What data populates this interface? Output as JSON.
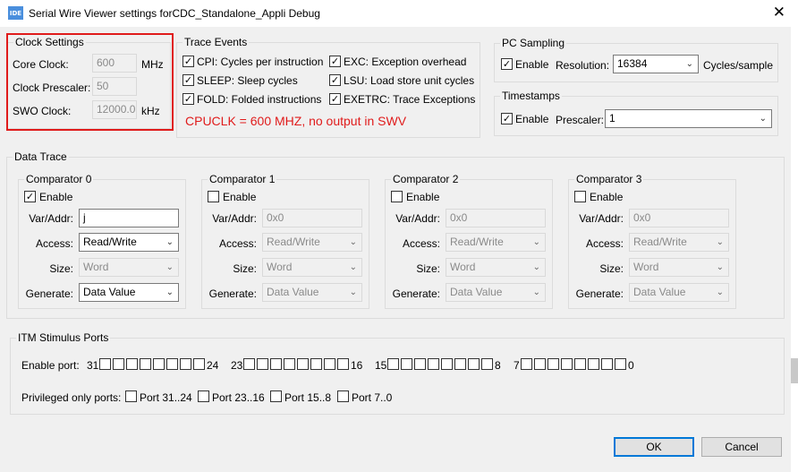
{
  "window": {
    "icon_text": "IDE",
    "title": "Serial Wire Viewer settings forCDC_Standalone_Appli Debug",
    "close_glyph": "✕"
  },
  "clock_settings": {
    "title": "Clock Settings",
    "core_clock_label": "Core Clock:",
    "core_clock_value": "600",
    "core_clock_unit": "MHz",
    "prescaler_label": "Clock Prescaler:",
    "prescaler_value": "50",
    "swo_clock_label": "SWO Clock:",
    "swo_clock_value": "12000.0",
    "swo_clock_unit": "kHz",
    "highlight_color": "#e01b1b"
  },
  "trace_events": {
    "title": "Trace Events",
    "items": [
      {
        "label": "CPI: Cycles per instruction",
        "checked": true
      },
      {
        "label": "SLEEP: Sleep cycles",
        "checked": true
      },
      {
        "label": "FOLD: Folded instructions",
        "checked": true
      },
      {
        "label": "EXC: Exception overhead",
        "checked": true
      },
      {
        "label": "LSU: Load store unit cycles",
        "checked": true
      },
      {
        "label": "EXETRC: Trace Exceptions",
        "checked": true
      }
    ],
    "note": "CPUCLK = 600 MHZ, no output in SWV",
    "note_color": "#e01b1b"
  },
  "pc_sampling": {
    "title": "PC Sampling",
    "enable_label": "Enable",
    "enable_checked": true,
    "resolution_label": "Resolution:",
    "resolution_value": "16384",
    "resolution_unit": "Cycles/sample"
  },
  "timestamps": {
    "title": "Timestamps",
    "enable_label": "Enable",
    "enable_checked": true,
    "prescaler_label": "Prescaler:",
    "prescaler_value": "1"
  },
  "data_trace": {
    "title": "Data Trace",
    "var_label": "Var/Addr:",
    "access_label": "Access:",
    "size_label": "Size:",
    "generate_label": "Generate:",
    "enable_label": "Enable",
    "comparators": [
      {
        "title": "Comparator 0",
        "enabled": true,
        "var": "j",
        "access": "Read/Write",
        "size": "Word",
        "generate": "Data Value"
      },
      {
        "title": "Comparator 1",
        "enabled": false,
        "var": "0x0",
        "access": "Read/Write",
        "size": "Word",
        "generate": "Data Value"
      },
      {
        "title": "Comparator 2",
        "enabled": false,
        "var": "0x0",
        "access": "Read/Write",
        "size": "Word",
        "generate": "Data Value"
      },
      {
        "title": "Comparator 3",
        "enabled": false,
        "var": "0x0",
        "access": "Read/Write",
        "size": "Word",
        "generate": "Data Value"
      }
    ]
  },
  "itm": {
    "title": "ITM Stimulus Ports",
    "enable_port_label": "Enable port:",
    "groups": [
      {
        "start": "31",
        "end": "24"
      },
      {
        "start": "23",
        "end": "16"
      },
      {
        "start": "15",
        "end": "8"
      },
      {
        "start": "7",
        "end": "0"
      }
    ],
    "privileged_label": "Privileged only ports:",
    "privileged": [
      "Port 31..24",
      "Port 23..16",
      "Port 15..8",
      "Port 7..0"
    ]
  },
  "buttons": {
    "ok": "OK",
    "cancel": "Cancel"
  },
  "icons": {
    "check": "✓",
    "chevron": "⌄"
  },
  "colors": {
    "accent": "#0078d7",
    "app_icon": "#4a8fdd"
  }
}
